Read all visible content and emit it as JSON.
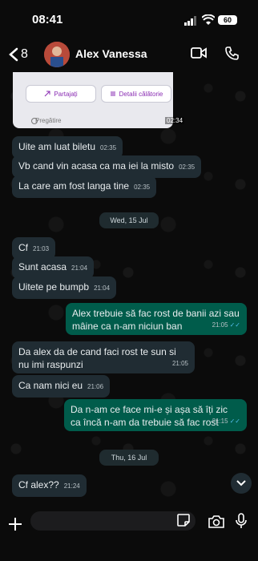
{
  "status_bar": {
    "time": "08:41",
    "battery": "60"
  },
  "header": {
    "back_count": "8",
    "contact_name": "Alex Vanessa"
  },
  "card": {
    "share_label": "Partajați",
    "details_label": "Detalii călătorie",
    "status_label": "Pregătire",
    "time": "02:34"
  },
  "messages": [
    {
      "text": "Uite am luat biletu",
      "time": "02:35"
    },
    {
      "text": "Vb cand vin acasa ca ma iei la misto",
      "time": "02:35"
    },
    {
      "text": "La care am fost langa tine",
      "time": "02:35"
    },
    {
      "text": "Cf",
      "time": "21:03"
    },
    {
      "text": "Sunt acasa",
      "time": "21:04"
    },
    {
      "text": "Uitete pe bumpb",
      "time": "21:04"
    },
    {
      "text": "Alex trebuie să fac rost de banii azi sau mâine ca n-am niciun ban",
      "time": "21:05"
    },
    {
      "text": "Da alex da de cand faci rost te sun si nu imi raspunzi",
      "time": "21:05"
    },
    {
      "text": "Ca nam nici eu",
      "time": "21:06"
    },
    {
      "text": "Da n-am ce face mi-e și așa să îți zic ca încă n-am da trebuie să fac rost",
      "time": "21:15"
    },
    {
      "text": "Cf alex??",
      "time": "21:24"
    }
  ],
  "dates": {
    "d1": "Wed, 15 Jul",
    "d2": "Thu, 16 Jul"
  },
  "colors": {
    "incoming": "#202c33",
    "outgoing": "#005c4b",
    "background": "#0b0b0b",
    "read_tick": "#53bdeb"
  },
  "icons": [
    "back-chevron-icon",
    "video-call-icon",
    "phone-icon",
    "plus-icon",
    "sticker-icon",
    "camera-icon",
    "microphone-icon",
    "scroll-down-icon",
    "share-icon",
    "list-icon"
  ]
}
